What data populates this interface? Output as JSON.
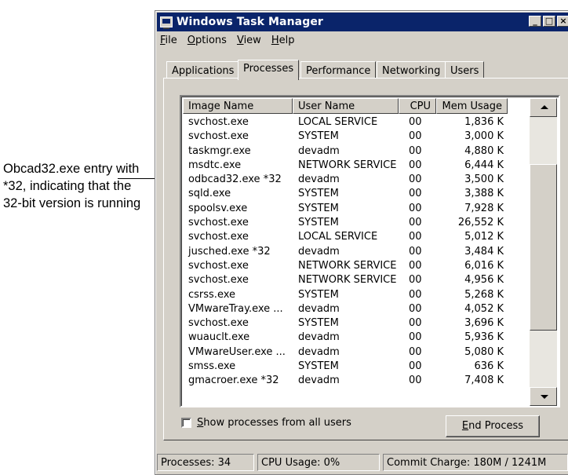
{
  "annotation": {
    "text": "Obcad32.exe entry with *32, indicating that the 32-bit version is running"
  },
  "window": {
    "title": "Windows Task Manager",
    "buttons": {
      "minimize": "_",
      "maximize": "□",
      "close": "×"
    }
  },
  "menu": [
    {
      "label": "File",
      "key": "F",
      "rest": "ile"
    },
    {
      "label": "Options",
      "key": "O",
      "rest": "ptions"
    },
    {
      "label": "View",
      "key": "V",
      "rest": "iew"
    },
    {
      "label": "Help",
      "key": "H",
      "rest": "elp"
    }
  ],
  "tabs": [
    "Applications",
    "Processes",
    "Performance",
    "Networking",
    "Users"
  ],
  "active_tab": "Processes",
  "columns": [
    "Image Name",
    "User Name",
    "CPU",
    "Mem Usage"
  ],
  "processes": [
    {
      "name": "svchost.exe",
      "user": "LOCAL SERVICE",
      "cpu": "00",
      "mem": "1,836 K"
    },
    {
      "name": "svchost.exe",
      "user": "SYSTEM",
      "cpu": "00",
      "mem": "3,000 K"
    },
    {
      "name": "taskmgr.exe",
      "user": "devadm",
      "cpu": "00",
      "mem": "4,880 K"
    },
    {
      "name": "msdtc.exe",
      "user": "NETWORK SERVICE",
      "cpu": "00",
      "mem": "6,444 K"
    },
    {
      "name": "odbcad32.exe *32",
      "user": "devadm",
      "cpu": "00",
      "mem": "3,500 K"
    },
    {
      "name": "sqld.exe",
      "user": "SYSTEM",
      "cpu": "00",
      "mem": "3,388 K"
    },
    {
      "name": "spoolsv.exe",
      "user": "SYSTEM",
      "cpu": "00",
      "mem": "7,928 K"
    },
    {
      "name": "svchost.exe",
      "user": "SYSTEM",
      "cpu": "00",
      "mem": "26,552 K"
    },
    {
      "name": "svchost.exe",
      "user": "LOCAL SERVICE",
      "cpu": "00",
      "mem": "5,012 K"
    },
    {
      "name": "jusched.exe *32",
      "user": "devadm",
      "cpu": "00",
      "mem": "3,484 K"
    },
    {
      "name": "svchost.exe",
      "user": "NETWORK SERVICE",
      "cpu": "00",
      "mem": "6,016 K"
    },
    {
      "name": "svchost.exe",
      "user": "NETWORK SERVICE",
      "cpu": "00",
      "mem": "4,956 K"
    },
    {
      "name": "csrss.exe",
      "user": "SYSTEM",
      "cpu": "00",
      "mem": "5,268 K"
    },
    {
      "name": "VMwareTray.exe ...",
      "user": "devadm",
      "cpu": "00",
      "mem": "4,052 K"
    },
    {
      "name": "svchost.exe",
      "user": "SYSTEM",
      "cpu": "00",
      "mem": "3,696 K"
    },
    {
      "name": "wuauclt.exe",
      "user": "devadm",
      "cpu": "00",
      "mem": "5,936 K"
    },
    {
      "name": "VMwareUser.exe ...",
      "user": "devadm",
      "cpu": "00",
      "mem": "5,080 K"
    },
    {
      "name": "smss.exe",
      "user": "SYSTEM",
      "cpu": "00",
      "mem": "636 K"
    },
    {
      "name": "gmacroer.exe *32",
      "user": "devadm",
      "cpu": "00",
      "mem": "7,408 K"
    }
  ],
  "show_all": {
    "label_key": "S",
    "label_rest": "how processes from all users",
    "checked": false
  },
  "end_process": {
    "label_key": "E",
    "label_rest": "nd Process"
  },
  "status": {
    "processes": "Processes: 34",
    "cpu": "CPU Usage: 0%",
    "commit": "Commit Charge: 180M / 1241M"
  },
  "colors": {
    "titlebar": "#0a246a",
    "face": "#d4d0c8"
  }
}
